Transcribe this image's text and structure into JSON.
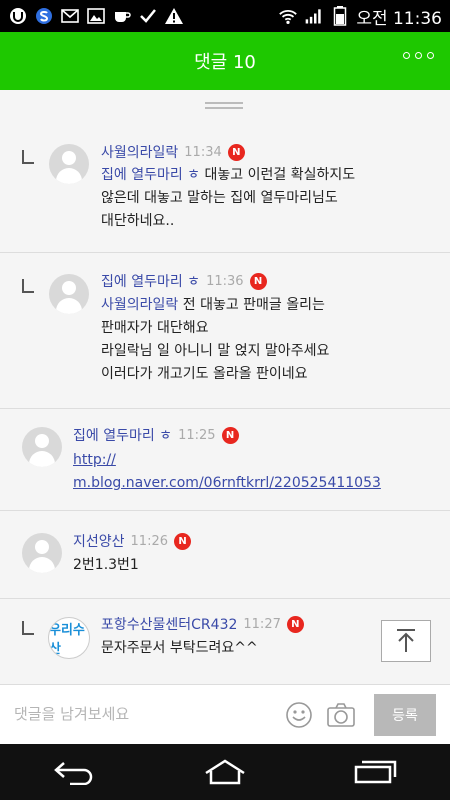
{
  "status_bar": {
    "time": "오전 11:36",
    "icons": [
      "u-plus-icon",
      "s-circle-icon",
      "mail-icon",
      "image-icon",
      "coffee-icon",
      "check-icon",
      "warning-icon",
      "wifi-icon",
      "signal-icon",
      "battery-icon"
    ]
  },
  "header": {
    "title": "댓글 10",
    "more_icon": "more-dots-icon",
    "color": "#1ec800"
  },
  "comments": [
    {
      "author": "사월의라일락",
      "time": "11:34",
      "badge": "N",
      "reply": true,
      "mention": "집에 열두마리 ㅎ",
      "lines": [
        "대놓고 이런걸 확실하지도",
        "않은데 대놓고 말하는 집에 열두마리님도",
        "대단하네요.."
      ]
    },
    {
      "author": "집에 열두마리 ㅎ",
      "time": "11:36",
      "badge": "N",
      "reply": true,
      "mention": "사월의라일락",
      "lines": [
        "전 대놓고 판매글 올리는",
        "판매자가 대단해요",
        "라일락님 일 아니니 말 얹지 말아주세요",
        "이러다가 개고기도 올라올 판이네요"
      ]
    },
    {
      "author": "집에 열두마리 ㅎ",
      "time": "11:25",
      "badge": "N",
      "reply": false,
      "lines": [
        "http://",
        "m.blog.naver.com/06rnftkrrl/220525411053"
      ]
    },
    {
      "author": "지선양산",
      "time": "11:26",
      "badge": "N",
      "reply": false,
      "lines": [
        "2번1.3번1"
      ]
    },
    {
      "author": "포항수산물센터CR432",
      "time": "11:27",
      "badge": "N",
      "reply": true,
      "avatar_text": "우리수산",
      "lines": [
        "문자주문서 부탁드려요^^"
      ]
    }
  ],
  "input_bar": {
    "placeholder": "댓글을 남겨보세요",
    "submit_label": "등록"
  },
  "nav_bar": {
    "icons": [
      "back-icon",
      "home-icon",
      "recent-apps-icon"
    ]
  }
}
